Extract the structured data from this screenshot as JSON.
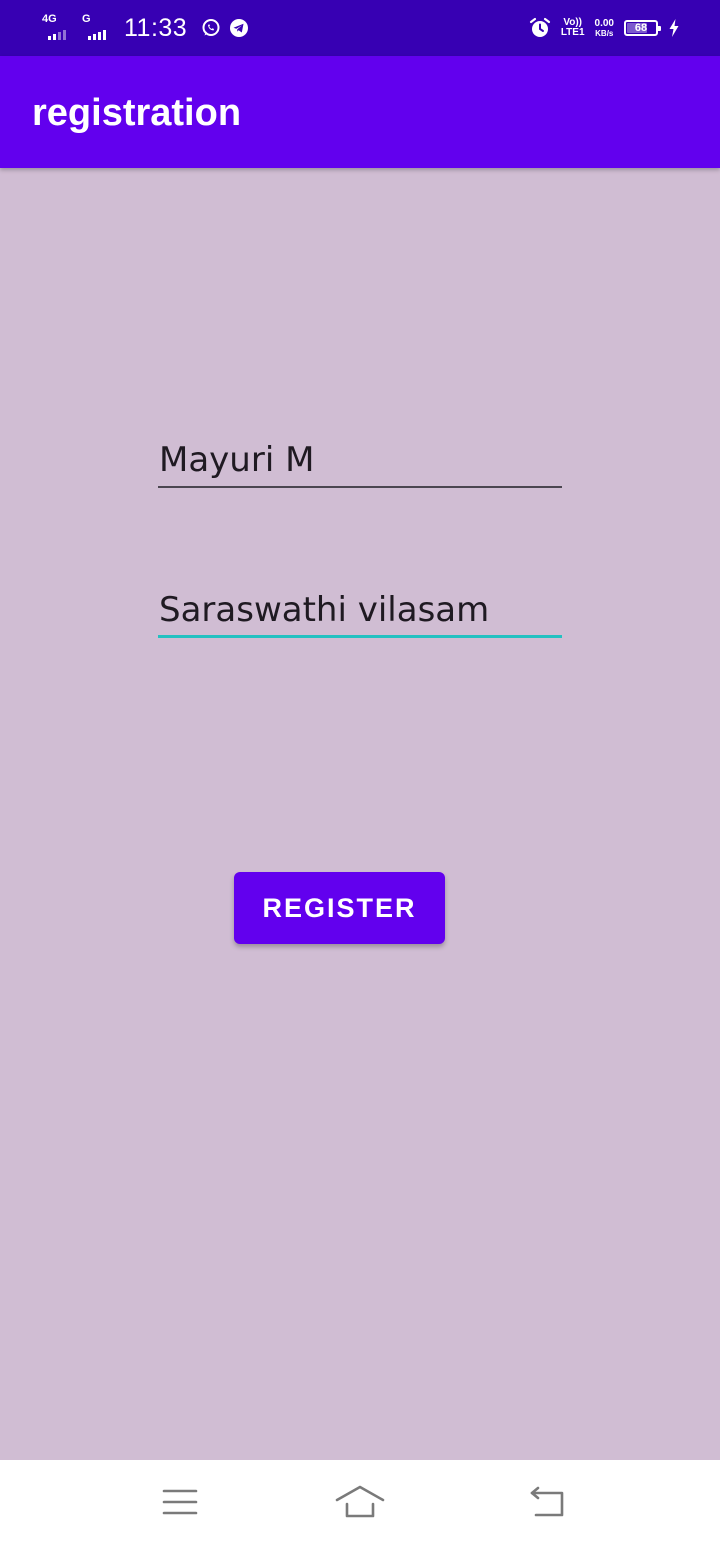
{
  "status_bar": {
    "network1": "4G",
    "network2": "G",
    "time": "11:33",
    "volte_top": "Vo))",
    "volte_bottom": "LTE1",
    "speed_value": "0.00",
    "speed_unit": "KB/s",
    "battery_level": "68",
    "battery_fraction": 0.68,
    "icons": [
      "signal-icon",
      "whatsapp-icon",
      "telegram-icon",
      "alarm-icon",
      "charging-icon"
    ]
  },
  "app_bar": {
    "title": "registration",
    "color": "#6200ee"
  },
  "form": {
    "name_value": "Mayuri M",
    "address_value": "Saraswathi vilasam",
    "focus_color": "#23c1c1",
    "background": "#d0bdd3"
  },
  "register_button": {
    "label": "REGISTER"
  },
  "nav_bar": {
    "icons": [
      "menu-icon",
      "home-icon",
      "back-icon"
    ]
  }
}
